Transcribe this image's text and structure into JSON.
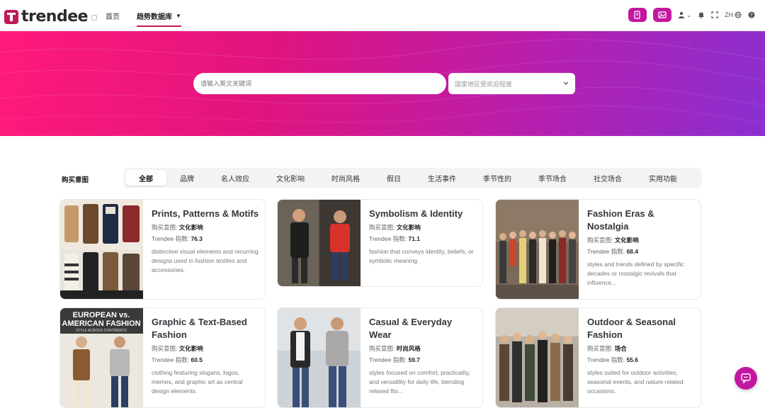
{
  "brand": {
    "name": "trendee"
  },
  "nav": {
    "home": "首页",
    "trend_db": "趋势数据库",
    "trend_caret": "▼"
  },
  "header_right": {
    "lang": "ZH"
  },
  "search": {
    "placeholder": "请输入英文关键词",
    "region_placeholder": "国家地区受欢迎程度"
  },
  "filter": {
    "label": "购买意图",
    "tabs": [
      "全部",
      "品牌",
      "名人效应",
      "文化影响",
      "时尚风格",
      "假日",
      "生活事件",
      "季节性的",
      "季节场合",
      "社交场合",
      "实用功能"
    ]
  },
  "cards": [
    {
      "title": "Prints, Patterns & Motifs",
      "intent_label": "购买意图:",
      "intent": "文化影响",
      "index_label": "Trendee 指数:",
      "index": "76.3",
      "desc": "distinctive visual elements and recurring designs used in fashion textiles and accessories."
    },
    {
      "title": "Symbolism & Identity",
      "intent_label": "购买意图:",
      "intent": "文化影响",
      "index_label": "Trendee 指数:",
      "index": "71.1",
      "desc": "fashion that conveys identity, beliefs, or symbolic meaning."
    },
    {
      "title": "Fashion Eras & Nostalgia",
      "intent_label": "购买意图:",
      "intent": "文化影响",
      "index_label": "Trendee 指数:",
      "index": "68.4",
      "desc": "styles and trends defined by specific decades or nostalgic revivals that influence..."
    },
    {
      "title": "Graphic & Text-Based Fashion",
      "intent_label": "购买意图:",
      "intent": "文化影响",
      "index_label": "Trendee 指数:",
      "index": "60.5",
      "desc": "clothing featuring slogans, logos, memes, and graphic art as central design elements.",
      "img_text": {
        "line1": "EUROPEAN vs.",
        "line2": "AMERICAN FASHION",
        "line3": "STYLE ACROSS CONTINENTS"
      }
    },
    {
      "title": "Casual & Everyday Wear",
      "intent_label": "购买意图:",
      "intent": "时尚风格",
      "index_label": "Trendee 指数:",
      "index": "59.7",
      "desc": "styles focused on comfort, practicality, and versatility for daily life, blending relaxed fits..."
    },
    {
      "title": "Outdoor & Seasonal Fashion",
      "intent_label": "购买意图:",
      "intent": "场合",
      "index_label": "Trendee 指数:",
      "index": "55.6",
      "desc": "styles suited for outdoor activities, seasonal events, and nature-related occasions."
    }
  ],
  "colors": {
    "accent": "#c2189f",
    "hero_start": "#ff1a7a",
    "hero_end": "#8a2fd0"
  }
}
